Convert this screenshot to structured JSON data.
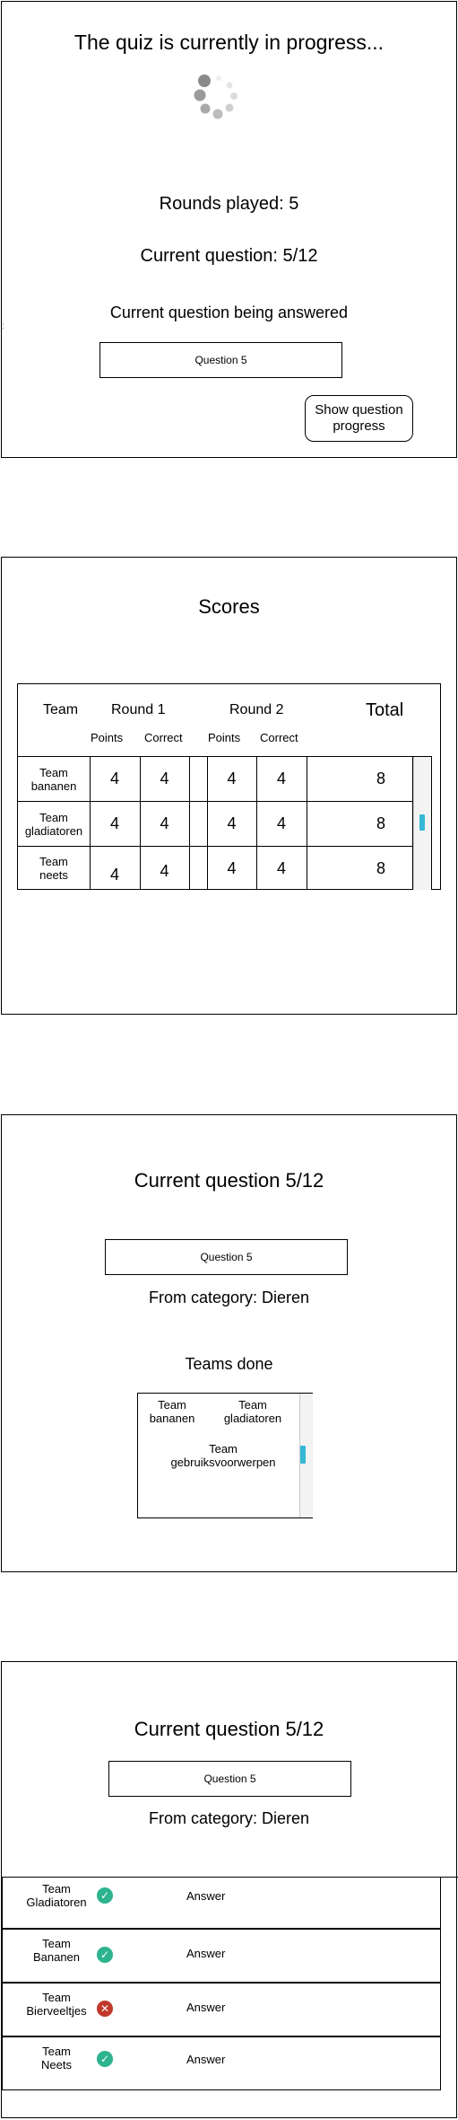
{
  "screen1": {
    "title": "The quiz is currently in progress...",
    "rounds_played": "Rounds played: 5",
    "current_question": "Current question: 5/12",
    "being_answered_label": "Current question being answered",
    "colon": ":",
    "question_box": "Question 5",
    "show_progress_button_line1": "Show question",
    "show_progress_button_line2": "progress"
  },
  "screen2": {
    "title": "Scores",
    "headers": {
      "team": "Team",
      "round1": "Round 1",
      "round2": "Round 2",
      "total": "Total"
    },
    "subheaders": [
      "Points",
      "Correct",
      "Points",
      "Correct"
    ],
    "rows": [
      {
        "team_line1": "Team",
        "team_line2": "bananen",
        "r1_points": "4",
        "r1_correct": "4",
        "r2_points": "4",
        "r2_correct": "4",
        "total": "8"
      },
      {
        "team_line1": "Team",
        "team_line2": "gladiatoren",
        "r1_points": "4",
        "r1_correct": "4",
        "r2_points": "4",
        "r2_correct": "4",
        "total": "8"
      },
      {
        "team_line1": "Team",
        "team_line2": "neets",
        "r1_points": "4",
        "r1_correct": "4",
        "r2_points": "4",
        "r2_correct": "4",
        "total": "8"
      }
    ],
    "accent_color": "#35b8d6"
  },
  "screen3": {
    "title": "Current question 5/12",
    "question_box": "Question 5",
    "category": "From category: Dieren",
    "teams_done_label": "Teams done",
    "teams_done": [
      {
        "line1": "Team",
        "line2": "bananen"
      },
      {
        "line1": "Team",
        "line2": "gladiatoren"
      },
      {
        "line1": "Team",
        "line2": "gebruiksvoorwerpen"
      }
    ]
  },
  "screen4": {
    "title": "Current question 5/12",
    "question_box": "Question 5",
    "category": "From category: Dieren",
    "answers": [
      {
        "team_line1": "Team",
        "team_line2": "Gladiatoren",
        "status": "correct",
        "answer": "Answer"
      },
      {
        "team_line1": "Team",
        "team_line2": "Bananen",
        "status": "correct",
        "answer": "Answer"
      },
      {
        "team_line1": "Team",
        "team_line2": "Bierveeltjes",
        "status": "wrong",
        "answer": "Answer"
      },
      {
        "team_line1": "Team",
        "team_line2": "Neets",
        "status": "correct",
        "answer": "Answer"
      }
    ],
    "colors": {
      "correct": "#2db38d",
      "wrong": "#c0392b"
    }
  }
}
